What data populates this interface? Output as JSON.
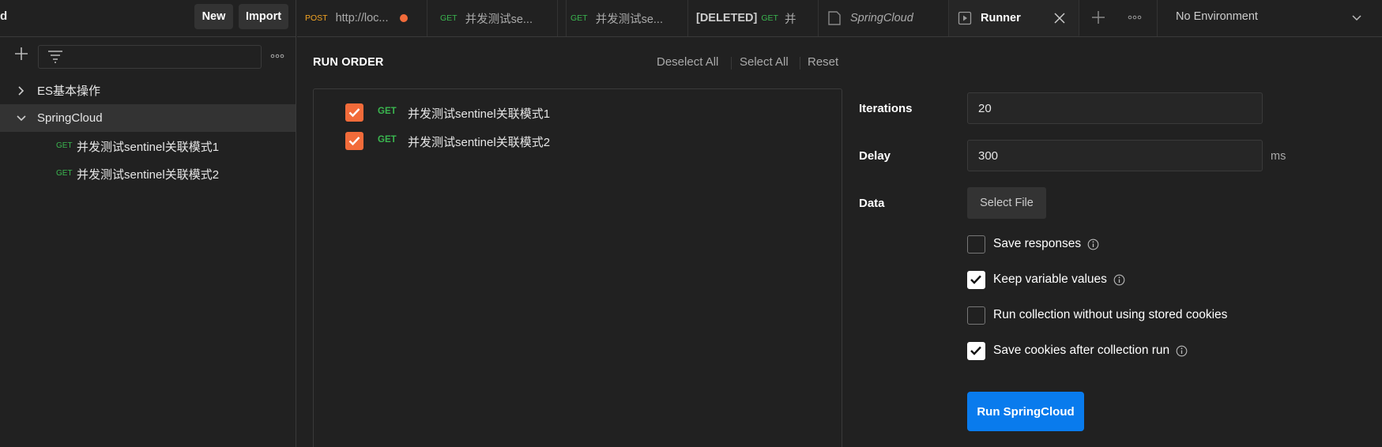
{
  "sidebar": {
    "cut_label": "d",
    "new_label": "New",
    "import_label": "Import",
    "filter_placeholder": "",
    "collections": [
      {
        "name": "ES基本操作",
        "expanded": false
      },
      {
        "name": "SpringCloud",
        "expanded": true
      }
    ],
    "requests": [
      {
        "method": "GET",
        "name": "并发测试sentinel关联模式1"
      },
      {
        "method": "GET",
        "name": "并发测试sentinel关联模式2"
      }
    ]
  },
  "tabs": [
    {
      "method": "POST",
      "title": "http://loc...",
      "unsaved": true
    },
    {
      "method": "GET",
      "title": "并发测试se..."
    },
    {
      "method": "GET",
      "title": "并发测试se..."
    },
    {
      "prefix": "[DELETED]",
      "method": "GET",
      "title": "并"
    },
    {
      "title": "SpringCloud"
    },
    {
      "title": "Runner",
      "active": true
    }
  ],
  "environment": "No Environment",
  "runner": {
    "run_order_title": "RUN ORDER",
    "deselect_all": "Deselect All",
    "select_all": "Select All",
    "reset": "Reset",
    "order": [
      {
        "method": "GET",
        "name": "并发测试sentinel关联模式1",
        "checked": true
      },
      {
        "method": "GET",
        "name": "并发测试sentinel关联模式2",
        "checked": true
      }
    ],
    "iterations_label": "Iterations",
    "iterations_value": "20",
    "delay_label": "Delay",
    "delay_value": "300",
    "delay_unit": "ms",
    "data_label": "Data",
    "select_file": "Select File",
    "options": [
      {
        "label": "Save responses",
        "checked": false,
        "info": true
      },
      {
        "label": "Keep variable values",
        "checked": true,
        "info": true
      },
      {
        "label": "Run collection without using stored cookies",
        "checked": false,
        "info": false
      },
      {
        "label": "Save cookies after collection run",
        "checked": true,
        "info": true
      }
    ],
    "run_button": "Run SpringCloud"
  },
  "colors": {
    "accent_orange": "#f26b3a",
    "method_get": "#3ab64f",
    "method_post": "#f5a623",
    "run_button": "#097bed"
  }
}
